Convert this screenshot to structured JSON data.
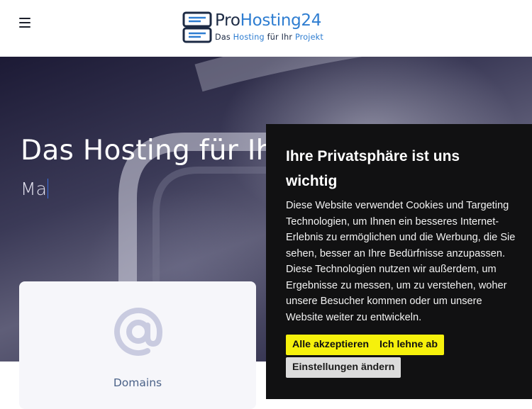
{
  "header": {
    "menu_icon": "hamburger-menu-icon",
    "logo": {
      "icon": "server-rack-icon",
      "name_part1": "Pro",
      "name_part2": "Hosting24",
      "tagline_1": "Das ",
      "tagline_2": "Hosting",
      "tagline_3": " für Ihr ",
      "tagline_4": "Projekt"
    }
  },
  "hero": {
    "title": "Das Hosting für Ih",
    "typed_text": "Ma"
  },
  "services": [
    {
      "icon": "at-sign-icon",
      "label": "Domains"
    }
  ],
  "cookie_banner": {
    "title": "Ihre Privatsphäre ist uns wichtig",
    "text": "Diese Website verwendet Cookies und Targeting Technologien, um Ihnen ein besseres Internet-Erlebnis zu ermöglichen und die Werbung, die Sie sehen, besser an Ihre Bedürfnisse anzupassen. Diese Technologien nutzen wir außerdem, um Ergebnisse zu messen, um zu verstehen, woher unsere Besucher kommen oder um unsere Website weiter zu entwickeln.",
    "accept_label": "Alle akzeptieren",
    "reject_label": "Ich lehne ab",
    "settings_label": "Einstellungen ändern"
  },
  "colors": {
    "brand_dark": "#1c2a44",
    "brand_accent": "#2e7dd1",
    "cookie_background": "#111112",
    "button_yellow": "#f6f10c",
    "button_grey": "#dcdcdc"
  }
}
